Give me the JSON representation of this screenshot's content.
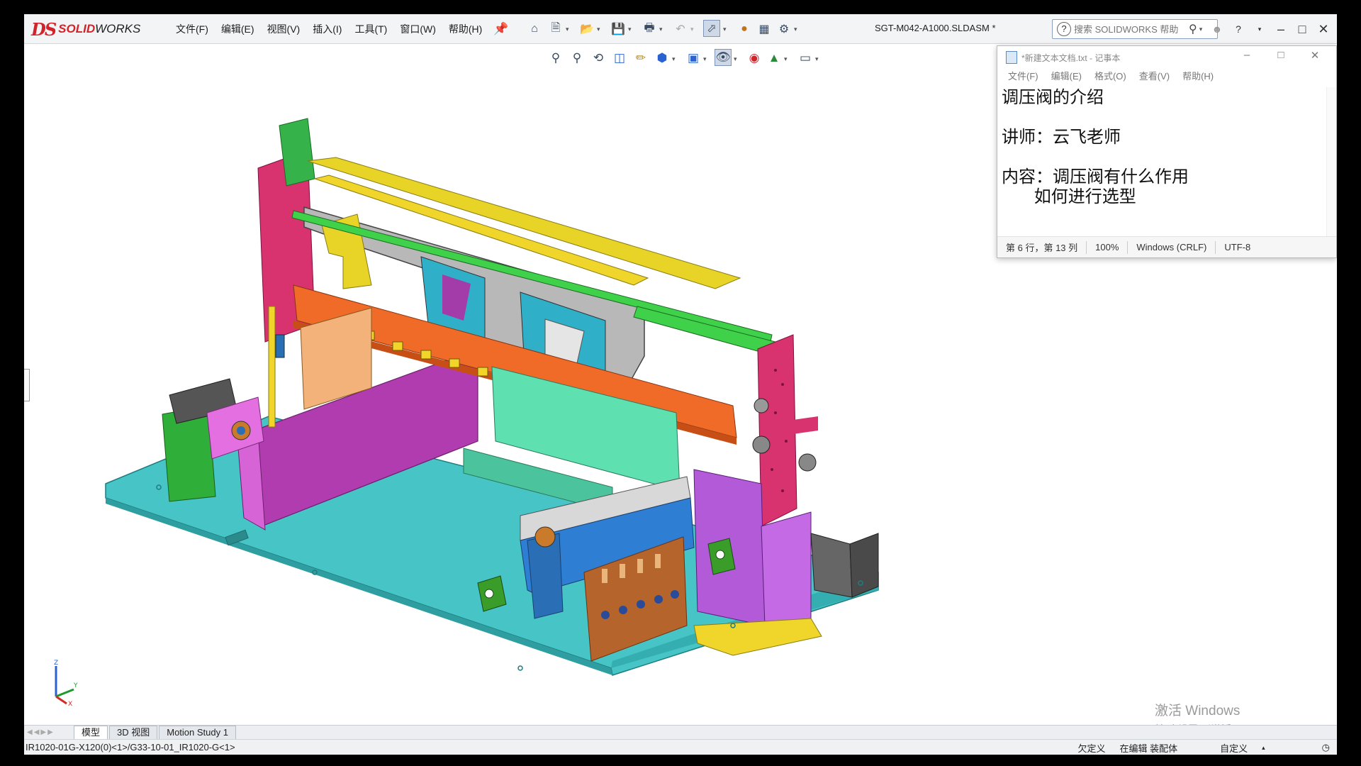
{
  "app": {
    "logo_ds": "DS",
    "logo_solid": "SOLID",
    "logo_works": "WORKS",
    "brand_color": "#d2232a"
  },
  "menu": [
    "文件(F)",
    "编辑(E)",
    "视图(V)",
    "插入(I)",
    "工具(T)",
    "窗口(W)",
    "帮助(H)"
  ],
  "toolbar_icons": [
    "home-icon",
    "new-document-icon",
    "open-icon",
    "save-icon",
    "print-icon",
    "undo-icon",
    "select-icon",
    "traffic-light-icon",
    "file-properties-icon",
    "options-gear-icon"
  ],
  "document_title": "SGT-M042-A1000.SLDASM *",
  "help_search": {
    "placeholder": "搜索 SOLIDWORKS 帮助"
  },
  "hud_icons": [
    "zoom-to-fit-icon",
    "zoom-area-icon",
    "previous-view-icon",
    "section-view-icon",
    "dynamic-annotation-icon",
    "view-orientation-icon",
    "display-style-icon",
    "hide-show-items-icon",
    "edit-appearance-icon",
    "apply-scene-icon",
    "view-settings-icon"
  ],
  "notepad": {
    "title": "*新建文本文档.txt - 记事本",
    "menu": [
      "文件(F)",
      "编辑(E)",
      "格式(O)",
      "查看(V)",
      "帮助(H)"
    ],
    "content": "调压阀的介绍\n\n讲师：云飞老师\n\n内容：调压阀有什么作用\n      如何进行选型",
    "status": {
      "position": "第 6 行，第 13 列",
      "zoom": "100%",
      "line_ending": "Windows (CRLF)",
      "encoding": "UTF-8"
    }
  },
  "watermark": {
    "line1": "激活 Windows",
    "line2": "转到\"设置\"以激活 Windows。"
  },
  "tabs": [
    "模型",
    "3D 视图",
    "Motion Study 1"
  ],
  "status_bar": {
    "path": "IR1020-01G-X120(0)<1>/G33-10-01_IR1020-G<1>",
    "state1": "欠定义",
    "state2": "在编辑 装配体",
    "units": "自定义"
  },
  "triad": {
    "x": "X",
    "y": "Y",
    "z": "Z"
  }
}
